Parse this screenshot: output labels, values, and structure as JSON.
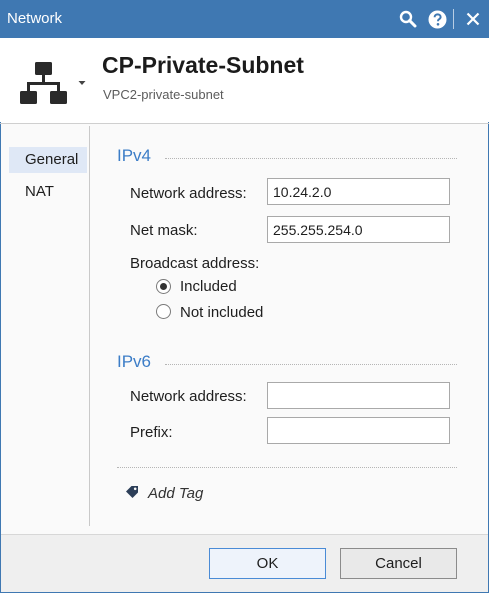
{
  "window": {
    "title": "Network"
  },
  "titlebar": {
    "icons": [
      "search-icon",
      "help-icon",
      "close-icon"
    ]
  },
  "header": {
    "name": "CP-Private-Subnet",
    "comment": "VPC2-private-subnet",
    "icon": "network-object-icon"
  },
  "nav": {
    "items": [
      {
        "label": "General",
        "active": true
      },
      {
        "label": "NAT",
        "active": false
      }
    ]
  },
  "ipv4": {
    "title": "IPv4",
    "network_address_label": "Network address:",
    "network_address_value": "10.24.2.0",
    "net_mask_label": "Net mask:",
    "net_mask_value": "255.255.254.0",
    "broadcast_label": "Broadcast address:",
    "broadcast_options": [
      {
        "label": "Included",
        "checked": true
      },
      {
        "label": "Not included",
        "checked": false
      }
    ]
  },
  "ipv6": {
    "title": "IPv6",
    "network_address_label": "Network address:",
    "network_address_value": "",
    "prefix_label": "Prefix:",
    "prefix_value": ""
  },
  "tags": {
    "add_label": "Add Tag",
    "icon": "tag-icon"
  },
  "footer": {
    "ok_label": "OK",
    "cancel_label": "Cancel"
  },
  "colors": {
    "titlebar": "#3f78b2",
    "section_title": "#3c7dc7",
    "nav_active": "#dfe8f6"
  }
}
